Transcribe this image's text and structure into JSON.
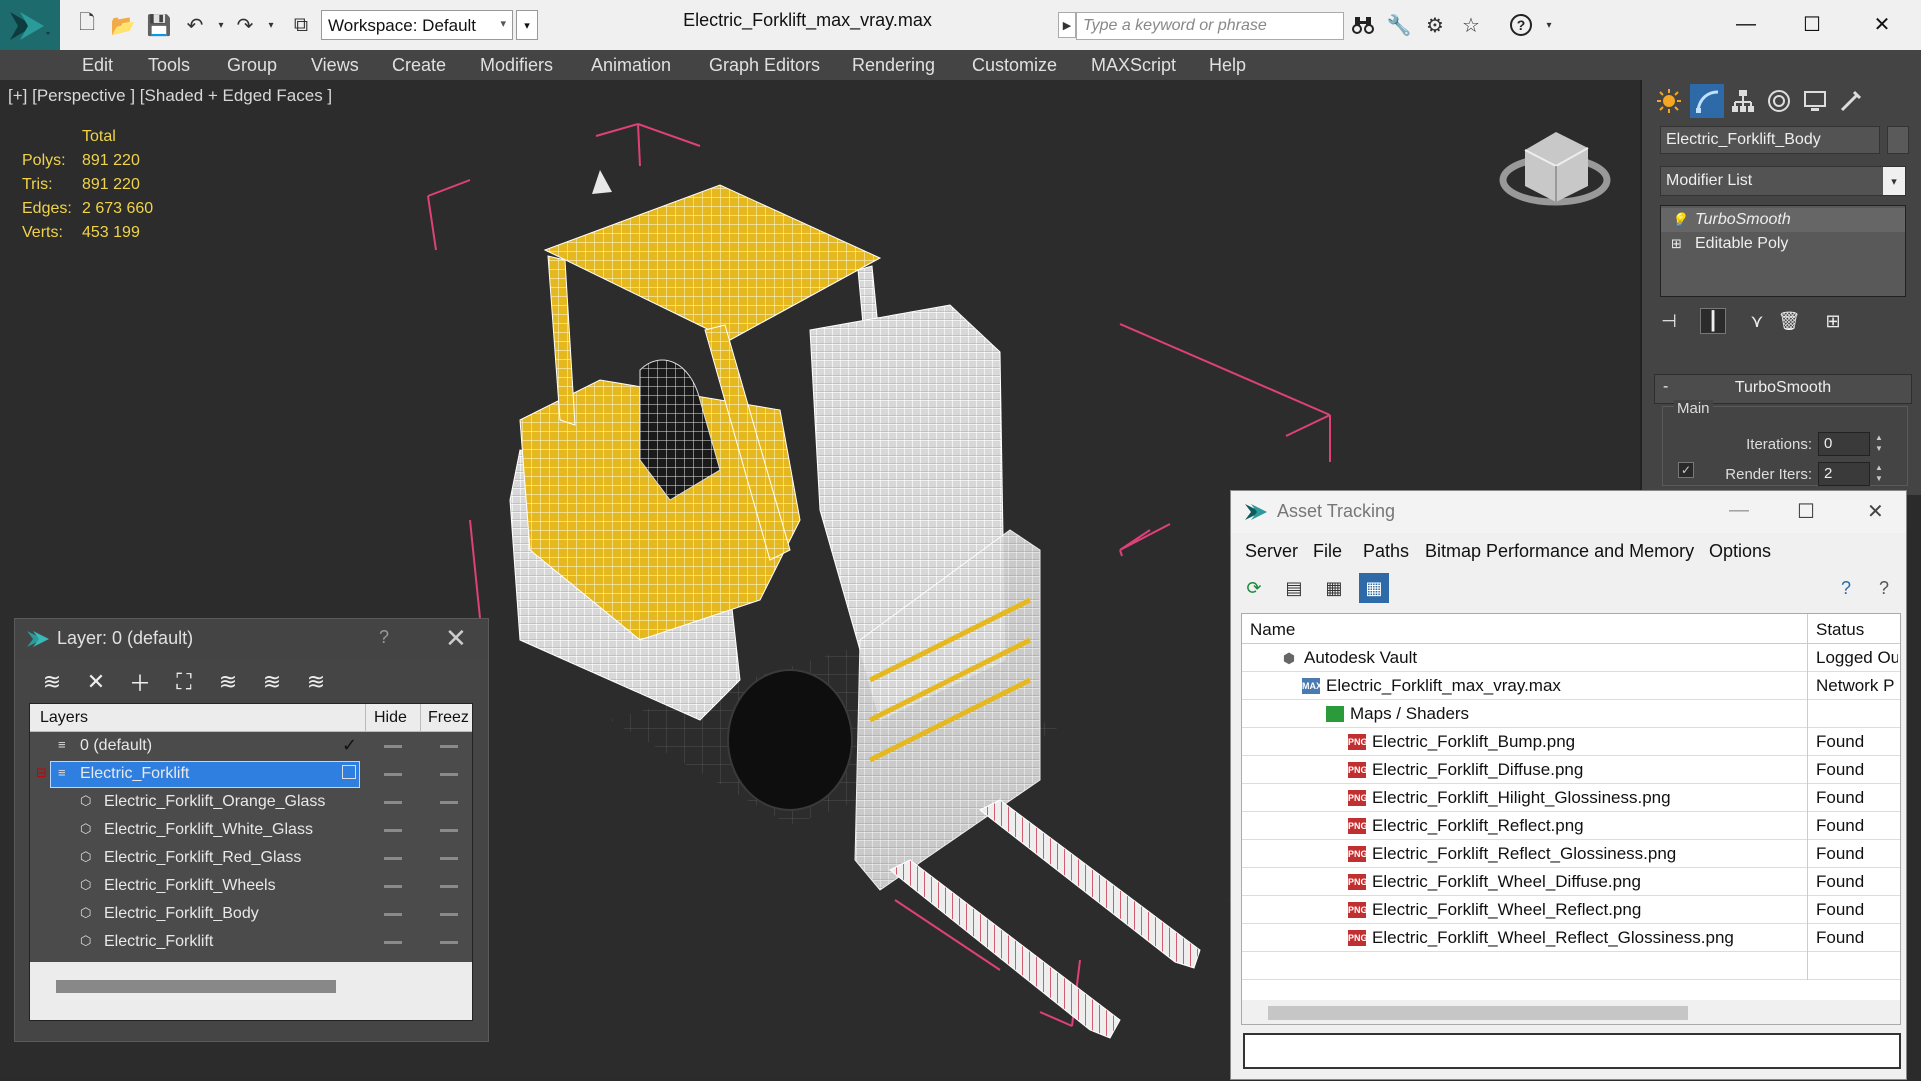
{
  "titlebar": {
    "workspace": "Workspace: Default",
    "document_title": "Electric_Forklift_max_vray.max",
    "search_placeholder": "Type a keyword or phrase"
  },
  "menu": [
    "Edit",
    "Tools",
    "Group",
    "Views",
    "Create",
    "Modifiers",
    "Animation",
    "Graph Editors",
    "Rendering",
    "Customize",
    "MAXScript",
    "Help"
  ],
  "viewport": {
    "label": "[+] [Perspective ] [Shaded + Edged Faces ]",
    "stats": {
      "header": "Total",
      "rows": [
        {
          "label": "Polys:",
          "value": "891 220"
        },
        {
          "label": "Tris:",
          "value": "891 220"
        },
        {
          "label": "Edges:",
          "value": "2 673 660"
        },
        {
          "label": "Verts:",
          "value": "453 199"
        }
      ]
    }
  },
  "command_panel": {
    "object_name": "Electric_Forklift_Body",
    "modifier_list": "Modifier List",
    "stack": [
      "TurboSmooth",
      "Editable Poly"
    ],
    "rollout_title": "TurboSmooth",
    "group_label": "Main",
    "iterations_label": "Iterations:",
    "iterations_value": "0",
    "render_iters_label": "Render Iters:",
    "render_iters_value": "2"
  },
  "layer_window": {
    "title": "Layer: 0 (default)",
    "help": "?",
    "columns": {
      "layers": "Layers",
      "hide": "Hide",
      "freeze": "Freez"
    },
    "rows": [
      {
        "name": "0 (default)",
        "level": 0
      },
      {
        "name": "Electric_Forklift",
        "level": 0,
        "selected": true
      },
      {
        "name": "Electric_Forklift_Orange_Glass",
        "level": 1
      },
      {
        "name": "Electric_Forklift_White_Glass",
        "level": 1
      },
      {
        "name": "Electric_Forklift_Red_Glass",
        "level": 1
      },
      {
        "name": "Electric_Forklift_Wheels",
        "level": 1
      },
      {
        "name": "Electric_Forklift_Body",
        "level": 1
      },
      {
        "name": "Electric_Forklift",
        "level": 1
      }
    ]
  },
  "asset_window": {
    "title": "Asset Tracking",
    "menu": [
      "Server",
      "File",
      "Paths",
      "Bitmap Performance and Memory",
      "Options"
    ],
    "columns": {
      "name": "Name",
      "status": "Status"
    },
    "rows": [
      {
        "name": "Autodesk Vault",
        "status": "Logged Out",
        "level": 0,
        "icon": "vault"
      },
      {
        "name": "Electric_Forklift_max_vray.max",
        "status": "Network P",
        "level": 1,
        "icon": "max"
      },
      {
        "name": "Maps / Shaders",
        "status": "",
        "level": 2,
        "icon": "maps"
      },
      {
        "name": "Electric_Forklift_Bump.png",
        "status": "Found",
        "level": 3,
        "icon": "png"
      },
      {
        "name": "Electric_Forklift_Diffuse.png",
        "status": "Found",
        "level": 3,
        "icon": "png"
      },
      {
        "name": "Electric_Forklift_Hilight_Glossiness.png",
        "status": "Found",
        "level": 3,
        "icon": "png"
      },
      {
        "name": "Electric_Forklift_Reflect.png",
        "status": "Found",
        "level": 3,
        "icon": "png"
      },
      {
        "name": "Electric_Forklift_Reflect_Glossiness.png",
        "status": "Found",
        "level": 3,
        "icon": "png"
      },
      {
        "name": "Electric_Forklift_Wheel_Diffuse.png",
        "status": "Found",
        "level": 3,
        "icon": "png"
      },
      {
        "name": "Electric_Forklift_Wheel_Reflect.png",
        "status": "Found",
        "level": 3,
        "icon": "png"
      },
      {
        "name": "Electric_Forklift_Wheel_Reflect_Glossiness.png",
        "status": "Found",
        "level": 3,
        "icon": "png"
      }
    ]
  },
  "icons": {
    "png_badge": "PNG",
    "max_badge": "MAX"
  },
  "colors": {
    "stats_text": "#f0d34a",
    "selection": "#2f7fe0",
    "bbox": "#e0407a",
    "forklift_yellow": "#e6b820"
  }
}
